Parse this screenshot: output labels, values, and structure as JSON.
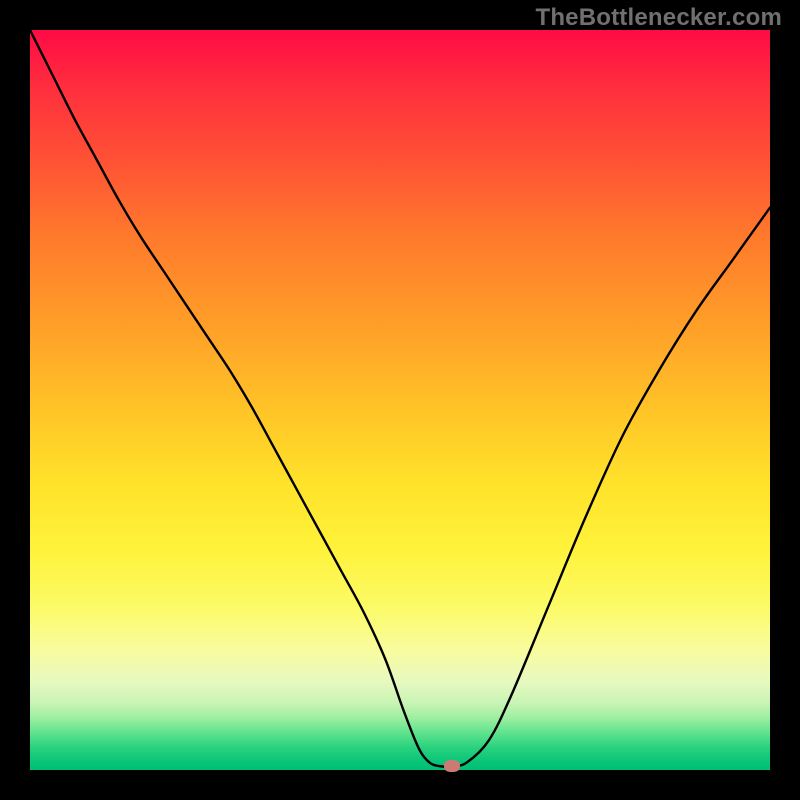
{
  "watermark": "TheBottlenecker.com",
  "colors": {
    "frame": "#000000",
    "curve": "#000000",
    "marker": "#cc7a74",
    "watermark_text": "#707070",
    "gradient_top": "#ff0b45",
    "gradient_bottom": "#00bf75"
  },
  "chart_data": {
    "type": "line",
    "title": "",
    "xlabel": "",
    "ylabel": "",
    "xlim": [
      0,
      100
    ],
    "ylim": [
      0,
      100
    ],
    "x": [
      0,
      3,
      6,
      9,
      12,
      15,
      18,
      21,
      24,
      27,
      30,
      33,
      36,
      39,
      42,
      45,
      48,
      50.5,
      52.5,
      54,
      55.5,
      57,
      59,
      62,
      65,
      70,
      75,
      80,
      85,
      90,
      95,
      100
    ],
    "values": [
      100,
      94,
      88,
      82.5,
      77,
      72,
      67.5,
      63,
      58.5,
      54,
      49,
      43.5,
      38,
      32.5,
      27,
      21.5,
      15,
      8,
      3,
      1,
      0.5,
      0.5,
      1,
      4,
      10,
      22,
      34,
      45,
      54,
      62,
      69,
      76
    ],
    "marker": {
      "x": 57,
      "y": 0.5
    },
    "grid": false,
    "legend": false
  }
}
